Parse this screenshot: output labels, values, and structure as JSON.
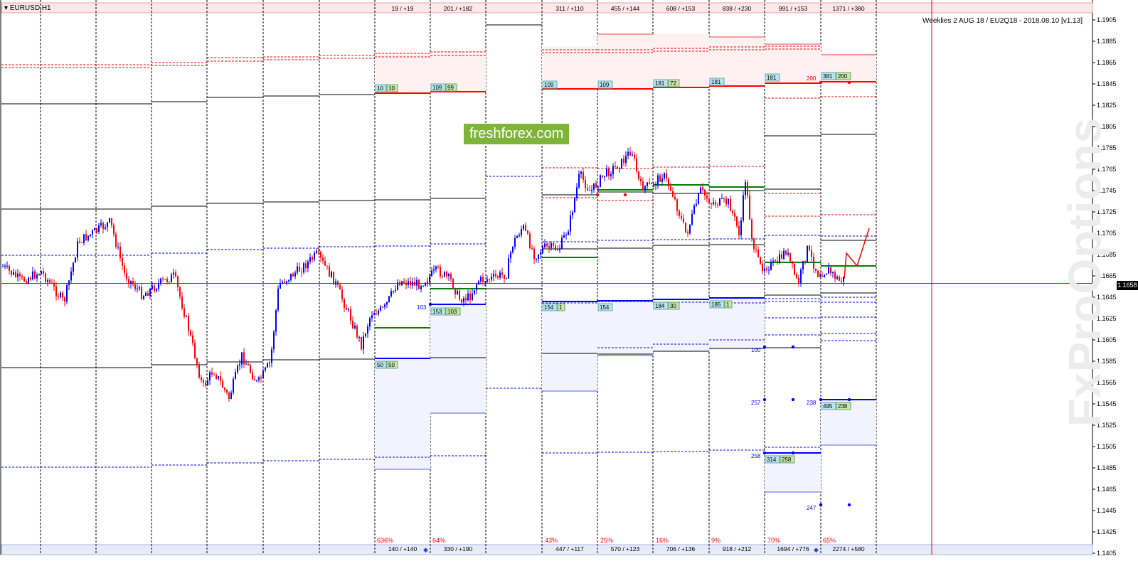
{
  "chart": {
    "symbol": "EURUSD,H1",
    "title": "Weeklies 2 AUG 18 / EU2Q18 - 2018.08.10 [v1.13]",
    "current_price": "1.1658",
    "watermark": "freshforex.com",
    "brand": "FxProOptions",
    "axis_ticks": [
      "1.1905",
      "1.1885",
      "1.1865",
      "1.1845",
      "1.1825",
      "1.1805",
      "1.1785",
      "1.1765",
      "1.1745",
      "1.1725",
      "1.1705",
      "1.1685",
      "1.1665",
      "1.1645",
      "1.1625",
      "1.1605",
      "1.1585",
      "1.1565",
      "1.1545",
      "1.1525",
      "1.1505",
      "1.1485",
      "1.1465",
      "1.1445",
      "1.1425",
      "1.1405"
    ],
    "top_stats": [
      "19 / +19",
      "201 / +182",
      "311 / +110",
      "455 / +144",
      "608 / +153",
      "838 / +230",
      "991 / +153",
      "1371 / +380"
    ],
    "bottom_stats": [
      "140 / +140",
      "330 / +190",
      "447 / +117",
      "570 / +123",
      "706 / +136",
      "918 / +212",
      "1694 / +776",
      "2274 / +580"
    ],
    "percents": [
      "636%",
      "64%",
      "43%",
      "25%",
      "16%",
      "9%",
      "70%",
      "65%"
    ],
    "upper_tags": [
      [
        "10",
        "10"
      ],
      [
        "109",
        "99"
      ],
      [
        "109",
        ""
      ],
      [
        "109",
        ""
      ],
      [
        "181",
        "72"
      ],
      [
        "181",
        ""
      ],
      [
        "181",
        ""
      ],
      [
        "381",
        "200"
      ]
    ],
    "lower_tags": [
      [
        "50",
        "50"
      ],
      [
        "153",
        "103"
      ],
      [
        "154",
        "1"
      ],
      [
        "154",
        ""
      ],
      [
        "184",
        "30"
      ],
      [
        "185",
        "1"
      ]
    ],
    "side_labels": {
      "l103": "103",
      "l200": "200",
      "l100": "100",
      "l257": "257",
      "l238": "238",
      "l258": "258",
      "l247": "247",
      "t495": [
        "495",
        "238"
      ],
      "t314": [
        "314",
        "258"
      ]
    },
    "colors": {
      "bull": "#0000ff",
      "bear": "#ff0000",
      "grid": "#000000",
      "level_green": "#008000",
      "tag_bg": "#b8e4f0",
      "tag_bg2": "#c8e6b0"
    }
  }
}
